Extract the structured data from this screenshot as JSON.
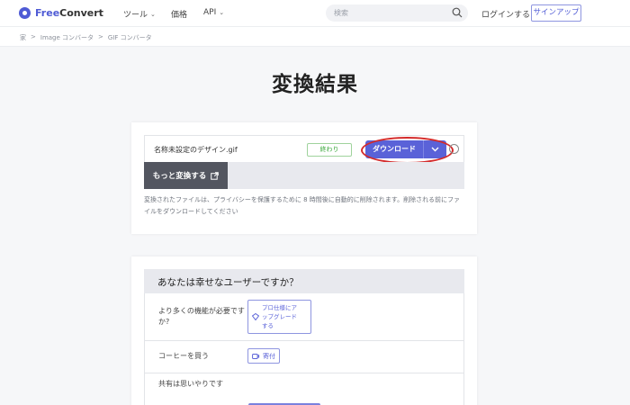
{
  "header": {
    "logo_free": "Free",
    "logo_convert": "Convert",
    "nav": [
      "ツール",
      "価格",
      "API"
    ],
    "search_placeholder": "検索",
    "login": "ログインする",
    "signup": "サインアップ"
  },
  "breadcrumb": [
    "家",
    ">",
    "Image コンバータ",
    ">",
    "GIF コンバータ"
  ],
  "page_title": "変換結果",
  "result": {
    "filename": "名称未設定のデザイン.gif",
    "status": "終わり",
    "download_label": "ダウンロード",
    "convert_more": "もっと変換する",
    "note_line1": "変換されたファイルは、プライバシーを保護するために 8 時間後に自動的に削除されます。削除される前にファ",
    "note_line2": "イルをダウンロードしてください"
  },
  "feedback": {
    "title": "あなたは幸せなユーザーですか？",
    "row1_label_line1": "より多くの機能が必要です",
    "row1_label_line2": "か?",
    "upgrade_line1": "プロ仕様にア",
    "upgrade_line2": "ップグレード",
    "upgrade_line3": "する",
    "row2_label": "コーヒーを買う",
    "donate": "寄付",
    "row3_label": "共有は思いやりです"
  },
  "colors": {
    "brand": "#4f5bd5",
    "download_button": "#5a62d8",
    "highlight_circle": "#d42b2b",
    "status_green": "#3aa83a"
  }
}
